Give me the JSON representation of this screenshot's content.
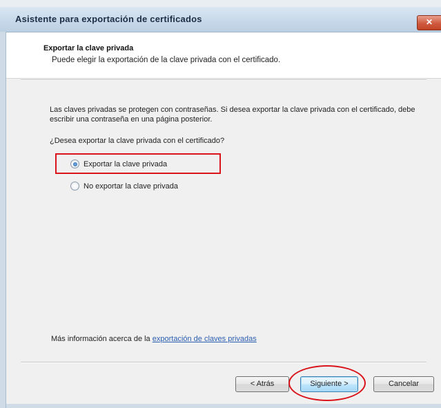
{
  "window": {
    "title": "Asistente para exportación de certificados",
    "close_symbol": "✕"
  },
  "header": {
    "title": "Exportar la clave privada",
    "subtitle": "Puede elegir la exportación de la clave privada con el certificado."
  },
  "body": {
    "description": "Las claves privadas se protegen con contraseñas. Si desea exportar la clave privada con el certificado, debe escribir una contraseña en una página posterior.",
    "question": "¿Desea exportar la clave privada con el certificado?",
    "options": [
      {
        "label": "Exportar la clave privada",
        "checked": true
      },
      {
        "label": "No exportar la clave privada",
        "checked": false
      }
    ],
    "more_info_prefix": "Más información acerca de la",
    "more_info_link": "exportación de claves privadas"
  },
  "buttons": {
    "back": "< Atrás",
    "next": "Siguiente >",
    "cancel": "Cancelar"
  },
  "colors": {
    "highlight": "#d9141b",
    "link": "#2a5db0"
  }
}
